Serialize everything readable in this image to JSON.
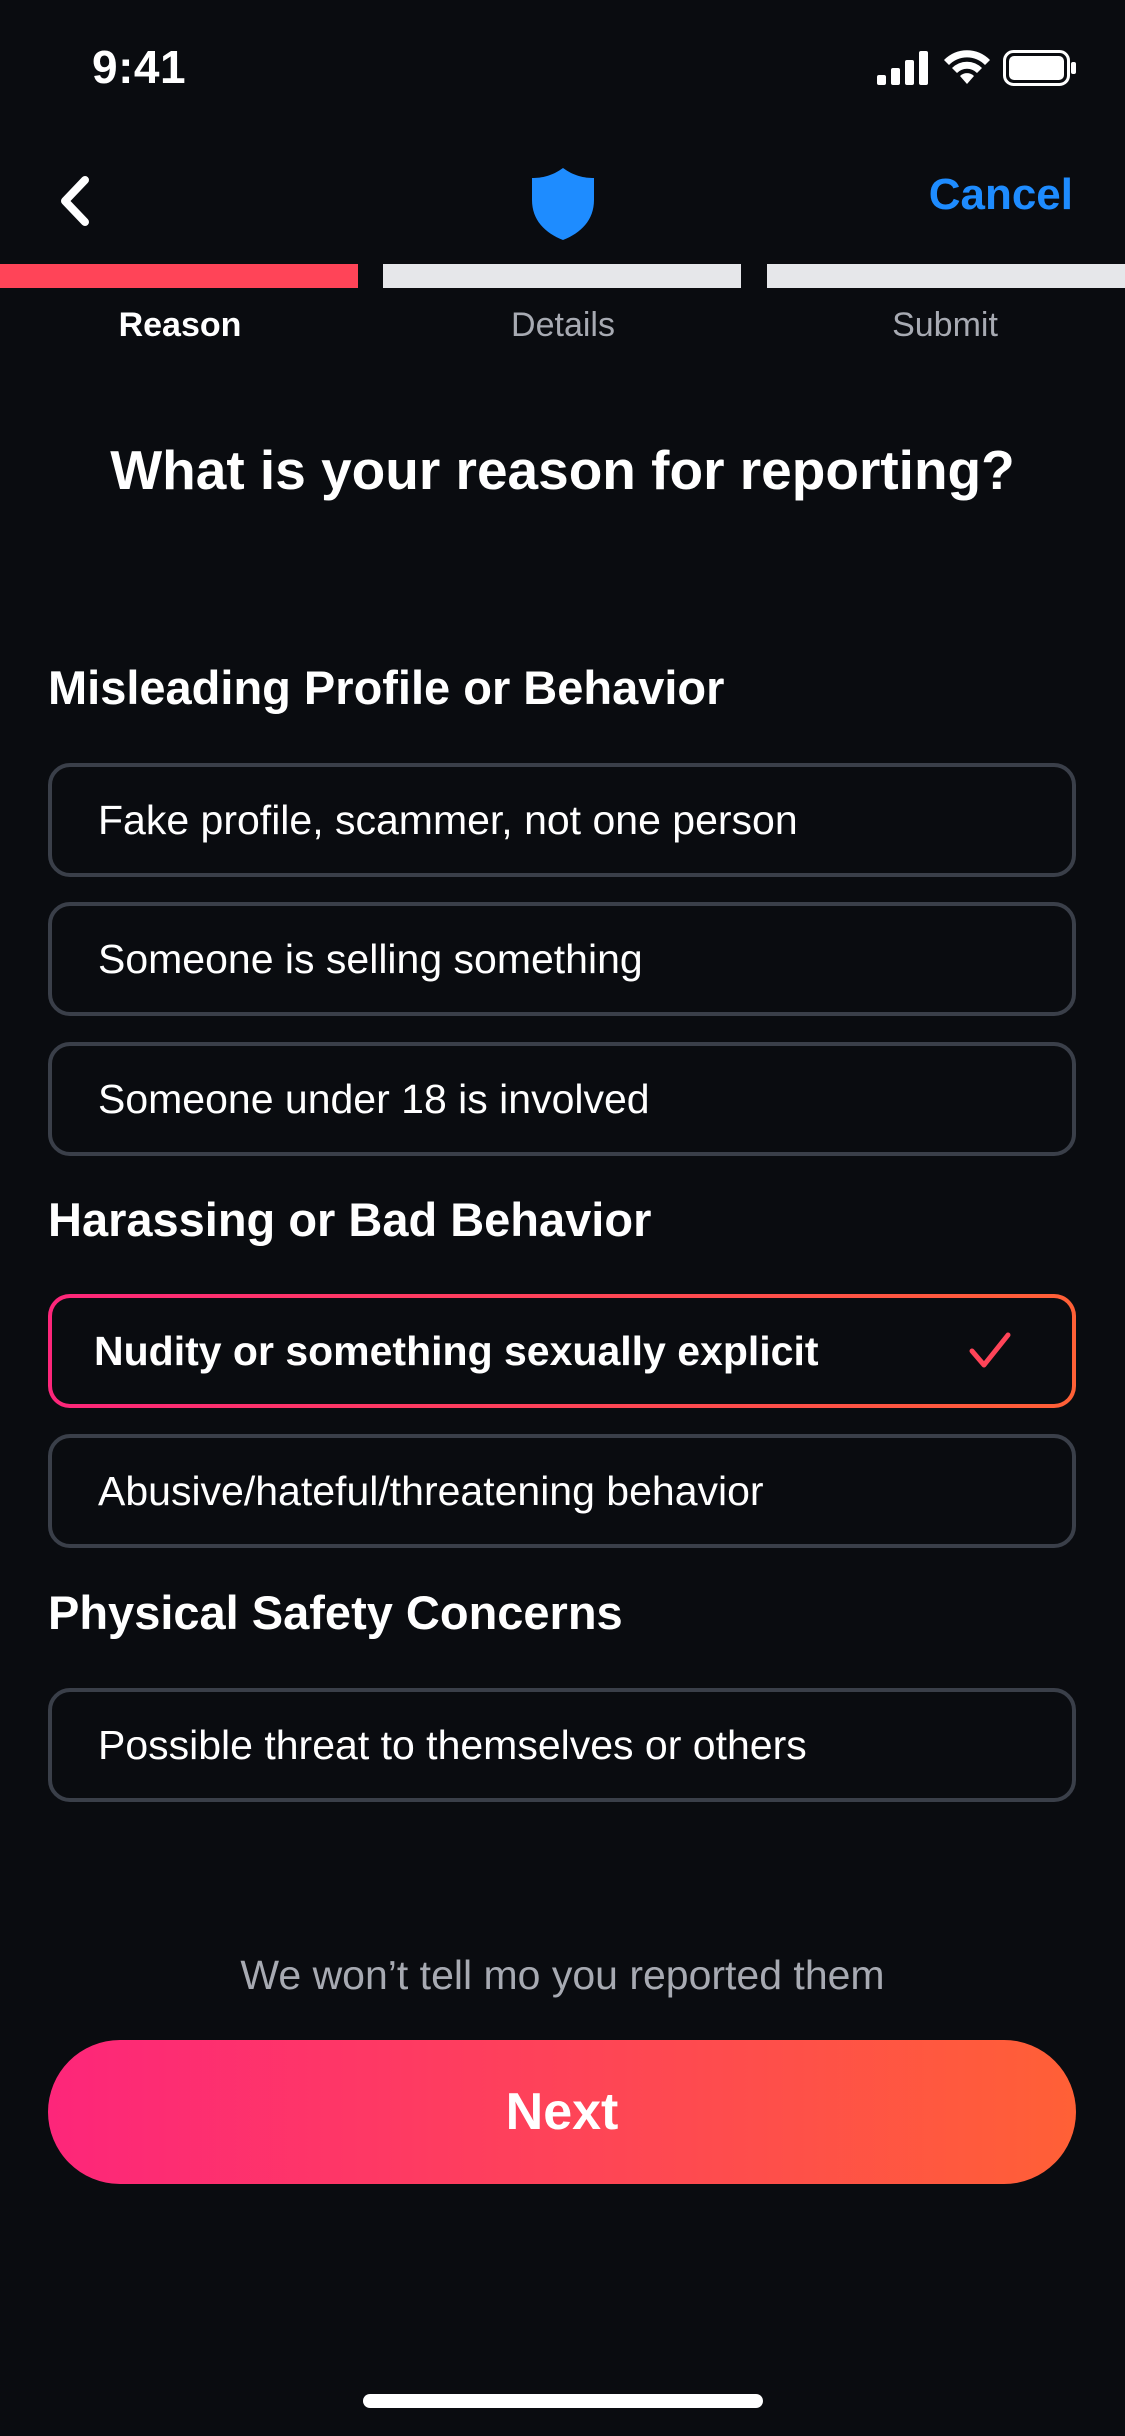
{
  "status_bar": {
    "time": "9:41",
    "icons": [
      "signal-icon",
      "wifi-icon",
      "battery-icon"
    ]
  },
  "nav": {
    "back_icon": "chevron-left-icon",
    "logo_icon": "shield-icon",
    "cancel_label": "Cancel"
  },
  "stepper": {
    "steps": [
      {
        "label": "Reason",
        "active": true
      },
      {
        "label": "Details",
        "active": false
      },
      {
        "label": "Submit",
        "active": false
      }
    ]
  },
  "title": "What is your reason for reporting?",
  "sections": [
    {
      "heading": "Misleading Profile or Behavior",
      "options": [
        {
          "label": "Fake profile, scammer, not one person",
          "selected": false
        },
        {
          "label": "Someone is selling something",
          "selected": false
        },
        {
          "label": "Someone under 18 is involved",
          "selected": false
        }
      ]
    },
    {
      "heading": "Harassing or Bad Behavior",
      "options": [
        {
          "label": "Nudity or something sexually explicit",
          "selected": true
        },
        {
          "label": "Abusive/hateful/threatening behavior",
          "selected": false
        }
      ]
    },
    {
      "heading": "Physical Safety Concerns",
      "options": [
        {
          "label": "Possible threat to themselves or others",
          "selected": false
        }
      ]
    }
  ],
  "footer": {
    "disclaimer": "We won’t tell mo you reported them",
    "next_label": "Next"
  },
  "colors": {
    "accent_blue": "#1e8cff",
    "brand_gradient_start": "#fd267a",
    "brand_gradient_end": "#ff6036",
    "progress_active": "#ff4458",
    "background": "#0a0c10"
  }
}
